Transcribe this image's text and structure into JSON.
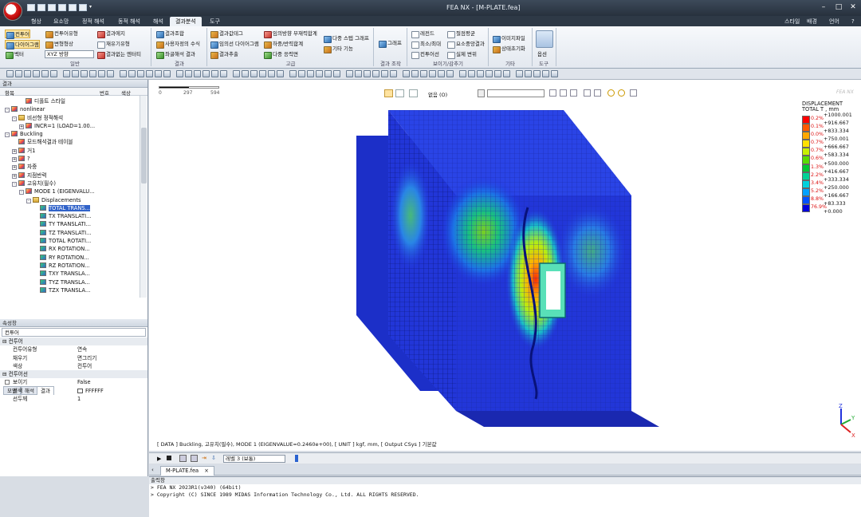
{
  "window": {
    "title": "FEA NX - [M-PLATE.fea]",
    "minimize": "–",
    "maximize": "□",
    "close": "✕"
  },
  "menu": {
    "tabs": [
      "형상",
      "요소망",
      "정적 해석",
      "동적 해석",
      "해석",
      "결과분석",
      "도구"
    ],
    "active_tab": "결과분석",
    "right": [
      "스타일",
      "배경",
      "언어",
      "?"
    ]
  },
  "ribbon": {
    "groups": [
      "일반",
      "결과",
      "고급",
      "결과 조작",
      "보이기/감추기",
      "기타",
      "도구"
    ],
    "general": {
      "contour": "컨투어",
      "contour_type": "컨투어유형",
      "result_edge": "결과에지",
      "diagram": "다이어그램",
      "deformed_shape": "변형형상",
      "redraw": "재유기유형",
      "vector": "벡터",
      "direction": "XYZ 방향",
      "result_entity": "결과없는 엔터티"
    },
    "results": {
      "combine": "결과조합",
      "user_formula": "사용자정의 수식",
      "post_result": "좌굴해석 결과"
    },
    "advanced": {
      "result_table": "결과값테그",
      "arbitrary_diagram": "임의선 다이어그램",
      "result_extract": "결과추출",
      "arbitrary_bending": "임의방향 부재력합계",
      "reaction_sum": "하중/반력합계",
      "multi_step": "다중 스텝 그래프",
      "multi_plane": "다중 응력면",
      "other": "기타 기능"
    },
    "graph": "그래프",
    "show_hide": {
      "legend": "레전드",
      "minmax": "최소/최대",
      "contour_line": "컨투어선",
      "node_avg": "절점평균",
      "elem_weight": "요소중앙결과",
      "real_scale": "실제 변위"
    },
    "others": {
      "image_file": "이미지파일",
      "state_save": "상태초기화"
    },
    "tools": {
      "options": "옵션"
    }
  },
  "left_panel": {
    "header": "결과",
    "columns": [
      "항목",
      "번호",
      "색상"
    ],
    "tree": [
      {
        "label": "디폴트 스타일",
        "indent": 2,
        "icon": "style"
      },
      {
        "label": "nonlinear",
        "indent": 0,
        "icon": "case",
        "exp": "-"
      },
      {
        "label": "비선형 정적해석",
        "indent": 1,
        "icon": "folder",
        "exp": "-"
      },
      {
        "label": "INCR=1 (LOAD=1.00...",
        "indent": 2,
        "icon": "case",
        "exp": "+"
      },
      {
        "label": "Buckling",
        "indent": 0,
        "icon": "case",
        "exp": "-"
      },
      {
        "label": "모드해석결과 테이블",
        "indent": 1,
        "icon": "style"
      },
      {
        "label": "거1",
        "indent": 1,
        "icon": "case",
        "exp": "+"
      },
      {
        "label": "?",
        "indent": 1,
        "icon": "case",
        "exp": "+"
      },
      {
        "label": "자중",
        "indent": 1,
        "icon": "case",
        "exp": "+"
      },
      {
        "label": "지점반력",
        "indent": 1,
        "icon": "case",
        "exp": "+"
      },
      {
        "label": "고유치(필수)",
        "indent": 1,
        "icon": "case",
        "exp": "-"
      },
      {
        "label": "MODE 1 (EIGENVALU...",
        "indent": 2,
        "icon": "case",
        "exp": "-"
      },
      {
        "label": "Displacements",
        "indent": 3,
        "icon": "folder",
        "exp": "-"
      },
      {
        "label": "TOTAL TRANS...",
        "indent": 4,
        "icon": "item",
        "selected": true
      },
      {
        "label": "TX TRANSLATI...",
        "indent": 4,
        "icon": "item"
      },
      {
        "label": "TY TRANSLATI...",
        "indent": 4,
        "icon": "item"
      },
      {
        "label": "TZ TRANSLATI...",
        "indent": 4,
        "icon": "item"
      },
      {
        "label": "TOTAL ROTATI...",
        "indent": 4,
        "icon": "item"
      },
      {
        "label": "RX ROTATION...",
        "indent": 4,
        "icon": "item"
      },
      {
        "label": "RY ROTATION...",
        "indent": 4,
        "icon": "item"
      },
      {
        "label": "RZ ROTATION...",
        "indent": 4,
        "icon": "item"
      },
      {
        "label": "TXY TRANSLA...",
        "indent": 4,
        "icon": "item"
      },
      {
        "label": "TYZ TRANSLA...",
        "indent": 4,
        "icon": "item"
      },
      {
        "label": "TZX TRANSLA...",
        "indent": 4,
        "icon": "item"
      }
    ],
    "tabs": [
      "모델",
      "해석",
      "결과"
    ],
    "active_tab": "결과"
  },
  "properties": {
    "header": "속성창",
    "object": "컨투어",
    "section1": "컨투어",
    "rows1": [
      {
        "k": "컨투어유형",
        "v": "연속"
      },
      {
        "k": "채우기",
        "v": "면그리기"
      },
      {
        "k": "색상",
        "v": "컨투어"
      }
    ],
    "section2": "컨투어선",
    "rows2": [
      {
        "k": "보이기",
        "v": "False"
      },
      {
        "k": "선색",
        "v": "FFFFFF"
      },
      {
        "k": "선두께",
        "v": "1"
      }
    ]
  },
  "viewport": {
    "ruler": [
      "0",
      "297",
      "594"
    ],
    "view_combo": "없음 (O)",
    "legend": {
      "title1": "DISPLACEMENT",
      "title2": "TOTAL T , mm",
      "levels": [
        "+1000.001",
        "+916.667",
        "+833.334",
        "+750.001",
        "+666.667",
        "+583.334",
        "+500.000",
        "+416.667",
        "+333.334",
        "+250.000",
        "+166.667",
        "+83.333",
        "+0.000"
      ],
      "percents": [
        "0.2%",
        "0.1%",
        "0.0%",
        "0.7%",
        "0.7%",
        "0.6%",
        "1.3%",
        "2.2%",
        "3.4%",
        "5.2%",
        "8.8%",
        "76.9%"
      ],
      "colors": [
        "#ff0000",
        "#ff5a00",
        "#ffa800",
        "#ffe000",
        "#c8f000",
        "#5adc00",
        "#00c832",
        "#00d296",
        "#00d2dc",
        "#00a0ff",
        "#0050ff",
        "#0000dc"
      ]
    },
    "logo": "FEA NX",
    "axes": {
      "z": "Z",
      "y": "Y",
      "x": "X"
    },
    "data_line": "[ DATA ] Buckling,  고유치(필수), MODE 1 (EIGENVALUE=0.2460e+00),  [ UNIT ]   kgf,  mm,  [ Output CSys ]  기본값"
  },
  "animation": {
    "level_combo": "레벨 3 (보통)"
  },
  "document_tab": {
    "name": "M-PLATE.fea",
    "close": "×"
  },
  "output": {
    "header": "출력창",
    "lines": [
      "> FEA NX 2023R1(v340) (64bit)",
      "> Copyright (C) SINCE 1989 MIDAS Information Technology Co., Ltd. ALL RIGHTS RESERVED."
    ]
  }
}
